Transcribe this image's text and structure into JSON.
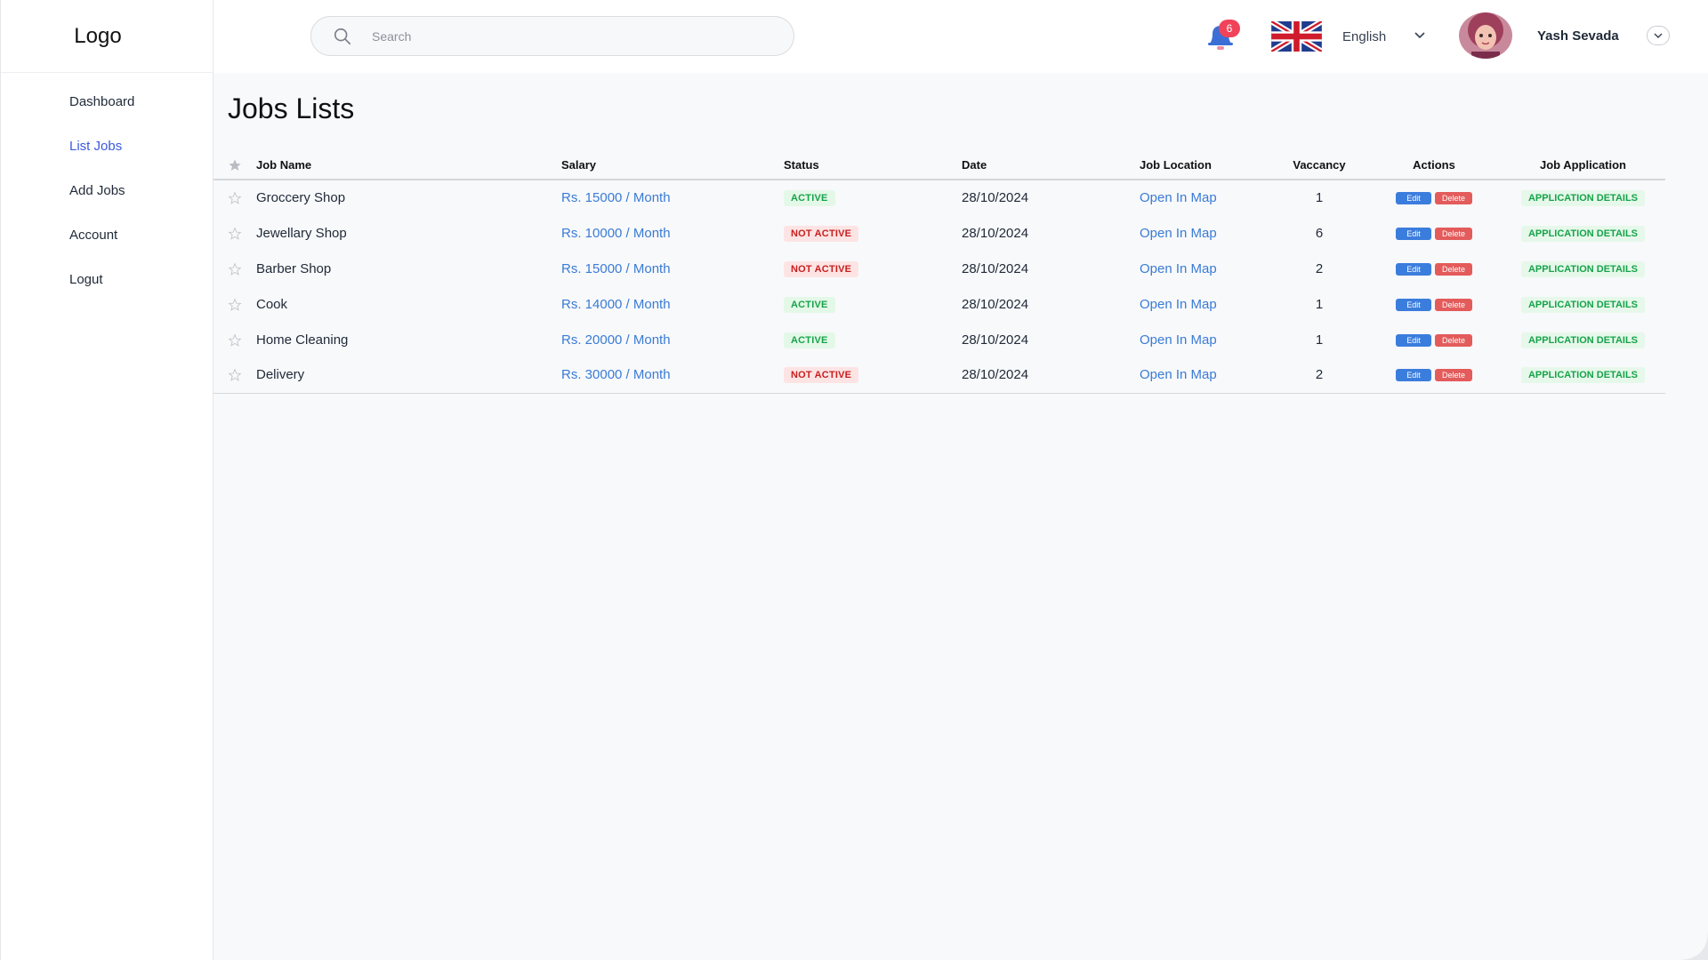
{
  "sidebar": {
    "logo": "Logo",
    "items": [
      {
        "label": "Dashboard",
        "active": false
      },
      {
        "label": "List Jobs",
        "active": true
      },
      {
        "label": "Add Jobs",
        "active": false
      },
      {
        "label": "Account",
        "active": false
      },
      {
        "label": "Logut",
        "active": false
      }
    ]
  },
  "header": {
    "search_placeholder": "Search",
    "notification_count": "6",
    "language": "English",
    "user_name": "Yash Sevada",
    "colors": {
      "bell": "#3b6fd6",
      "badge": "#f0435a"
    }
  },
  "main": {
    "title": "Jobs Lists",
    "columns": [
      "Job Name",
      "Salary",
      "Status",
      "Date",
      "Job Location",
      "Vaccancy",
      "Actions",
      "Job Application"
    ],
    "rows": [
      {
        "name": "Groccery Shop",
        "salary": "Rs. 15000 / Month",
        "status": "ACTIVE",
        "status_active": true,
        "date": "28/10/2024",
        "location": "Open In Map",
        "vacancy": "1",
        "edit": "Edit",
        "delete": "Delete",
        "app": "APPLICATION DETAILS"
      },
      {
        "name": "Jewellary Shop",
        "salary": "Rs. 10000 / Month",
        "status": "NOT ACTIVE",
        "status_active": false,
        "date": "28/10/2024",
        "location": "Open In Map",
        "vacancy": "6",
        "edit": "Edit",
        "delete": "Delete",
        "app": "APPLICATION DETAILS"
      },
      {
        "name": "Barber Shop",
        "salary": "Rs. 15000 / Month",
        "status": "NOT ACTIVE",
        "status_active": false,
        "date": "28/10/2024",
        "location": "Open In Map",
        "vacancy": "2",
        "edit": "Edit",
        "delete": "Delete",
        "app": "APPLICATION DETAILS"
      },
      {
        "name": "Cook",
        "salary": "Rs. 14000 / Month",
        "status": "ACTIVE",
        "status_active": true,
        "date": "28/10/2024",
        "location": "Open In Map",
        "vacancy": "1",
        "edit": "Edit",
        "delete": "Delete",
        "app": "APPLICATION DETAILS"
      },
      {
        "name": "Home Cleaning",
        "salary": "Rs. 20000 / Month",
        "status": "ACTIVE",
        "status_active": true,
        "date": "28/10/2024",
        "location": "Open In Map",
        "vacancy": "1",
        "edit": "Edit",
        "delete": "Delete",
        "app": "APPLICATION DETAILS"
      },
      {
        "name": "Delivery",
        "salary": "Rs. 30000 / Month",
        "status": "NOT ACTIVE",
        "status_active": false,
        "date": "28/10/2024",
        "location": "Open In Map",
        "vacancy": "2",
        "edit": "Edit",
        "delete": "Delete",
        "app": "APPLICATION DETAILS"
      }
    ]
  },
  "icons": [
    "search-icon",
    "bell-icon",
    "uk-flag-icon",
    "chevron-down-icon",
    "avatar",
    "star-icon"
  ],
  "colors": {
    "accent": "#3b5bdb",
    "link": "#3a7bd5",
    "active": "#16a34a",
    "inactive": "#c81e1e",
    "edit": "#3b7ddd",
    "delete": "#e35b5b"
  }
}
